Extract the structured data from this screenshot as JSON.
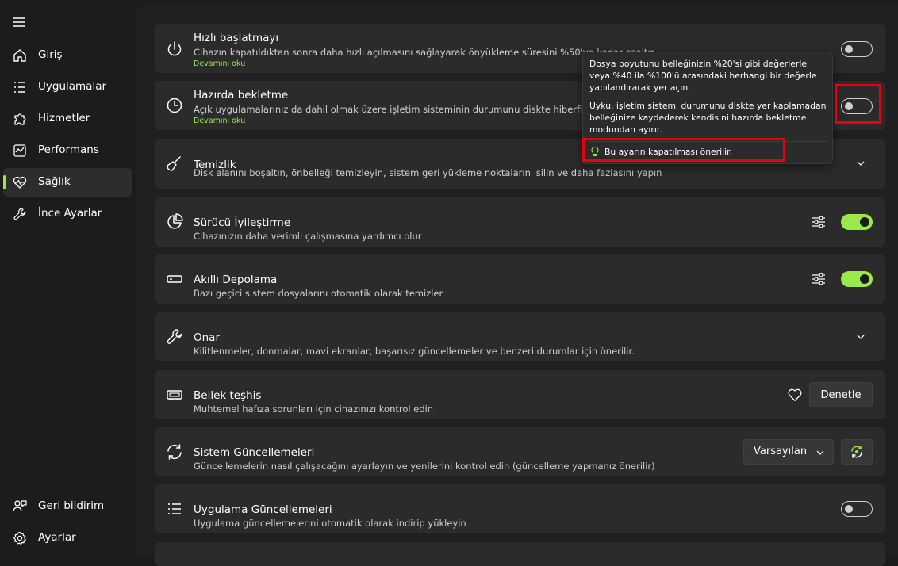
{
  "sidebar": {
    "items": [
      {
        "label": "Giriş",
        "icon": "home-icon"
      },
      {
        "label": "Uygulamalar",
        "icon": "list-icon"
      },
      {
        "label": "Hizmetler",
        "icon": "puzzle-icon"
      },
      {
        "label": "Performans",
        "icon": "chart-icon"
      },
      {
        "label": "Sağlık",
        "icon": "heart-pulse-icon",
        "active": true
      },
      {
        "label": "İnce Ayarlar",
        "icon": "wrench-icon"
      }
    ],
    "bottom": [
      {
        "label": "Geri bildirim",
        "icon": "feedback-icon"
      },
      {
        "label": "Ayarlar",
        "icon": "gear-icon"
      }
    ]
  },
  "cards": {
    "fast_startup": {
      "title": "Hızlı başlatmayı",
      "desc": "Cihazın kapatıldıktan sonra daha hızlı açılmasını sağlayarak önyükleme süresini %50'ye kadar azaltır.",
      "link": "Devamını oku",
      "toggle": "off"
    },
    "hibernate": {
      "title": "Hazırda bekletme",
      "desc": "Açık uygulamalarınız da dahil olmak üzere işletim sisteminin durumunu diskte hiberfil.sys a",
      "link": "Devamını oku",
      "toggle": "off"
    },
    "cleanup": {
      "title": "Temizlik",
      "desc": "Disk alanını boşaltın, önbelleği temizleyin, sistem geri yükleme noktalarını silin ve daha fazlasını yapın"
    },
    "driver": {
      "title": "Sürücü İyileştirme",
      "desc": "Cihazınızın daha verimli çalışmasına yardımcı olur",
      "toggle": "on"
    },
    "storage": {
      "title": "Akıllı Depolama",
      "desc": "Bazı geçici sistem dosyalarını otomatik olarak temizler",
      "toggle": "on"
    },
    "repair": {
      "title": "Onar",
      "desc": "Kilitlenmeler, donmalar, mavi ekranlar, başarısız güncellemeler ve benzeri durumlar için önerilir."
    },
    "memory": {
      "title": "Bellek teşhis",
      "desc": "Muhtemel hafıza sorunları için cihazınızı kontrol edin",
      "button": "Denetle"
    },
    "sys_updates": {
      "title": "Sistem Güncellemeleri",
      "desc": "Güncellemelerin nasıl çalışacağını ayarlayın ve yenilerini kontrol edin (güncelleme yapmanız önerilir)",
      "select": "Varsayılan"
    },
    "app_updates": {
      "title": "Uygulama Güncellemeleri",
      "desc": "Uygulama güncellemelerini otomatik olarak indirip yükleyin",
      "toggle": "off"
    }
  },
  "tooltip": {
    "p1": "Dosya boyutunu belleğinizin %20'si gibi değerlerle veya %40 ila %100'ü arasındaki herhangi bir değerle yapılandırarak yer açın.",
    "p2": "Uyku, işletim sistemi durumunu diskte yer kaplamadan belleğinize kaydederek kendisini hazırda bekletme modundan ayırır.",
    "tip": "Bu ayarın kapatılması önerilir."
  },
  "colors": {
    "accent": "#9be84a",
    "highlight": "#e8000b",
    "card": "#2b2b2b",
    "background": "#202020"
  }
}
